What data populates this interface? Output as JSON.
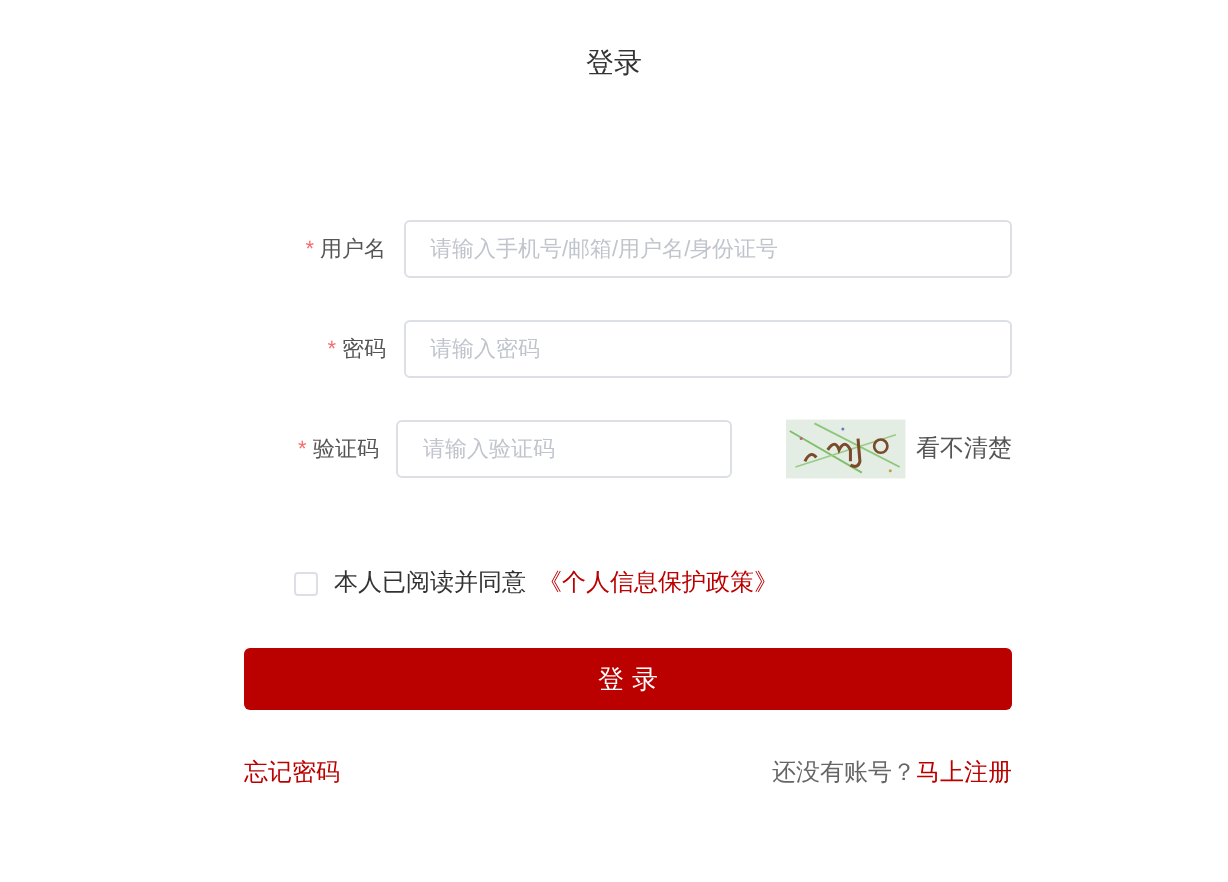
{
  "title": "登录",
  "fields": [
    {
      "label": "用户名",
      "required_mark": "*",
      "placeholder": "请输入手机号/邮箱/用户名/身份证号",
      "kind": "text"
    },
    {
      "label": "密码",
      "required_mark": "*",
      "placeholder": "请输入密码",
      "kind": "password"
    },
    {
      "label": "验证码",
      "required_mark": "*",
      "placeholder": "请输入验证码",
      "kind": "captcha",
      "refresh": "看不清楚"
    }
  ],
  "agreement": {
    "checked": false,
    "text": "本人已阅读并同意",
    "link": "《个人信息保护政策》"
  },
  "submit": "登 录",
  "forgot": "忘记密码",
  "register": {
    "prompt": "还没有账号？",
    "link": "马上注册"
  }
}
